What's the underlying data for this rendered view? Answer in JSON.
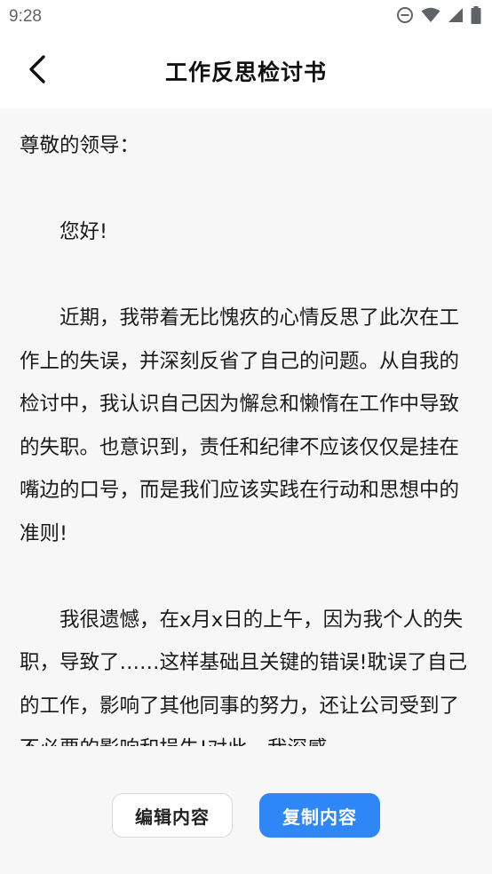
{
  "status_bar": {
    "time": "9:28",
    "icons": [
      "do-not-disturb-icon",
      "wifi-icon",
      "signal-icon",
      "battery-icon"
    ]
  },
  "header": {
    "title": "工作反思检讨书",
    "back_icon": "chevron-left-icon"
  },
  "document": {
    "salutation": "尊敬的领导：",
    "greeting": "您好!",
    "paragraphs": [
      "近期，我带着无比愧疚的心情反思了此次在工作上的失误，并深刻反省了自己的问题。从自我的检讨中，我认识自己因为懈怠和懒惰在工作中导致的失职。也意识到，责任和纪律不应该仅仅是挂在嘴边的口号，而是我们应该实践在行动和思想中的准则!",
      "我很遗憾，在x月x日的上午，因为我个人的失职，导致了……这样基础且关键的错误!耽误了自己的工作，影响了其他同事的努力，还让公司受到了不必要的影响和损失!对此，我深感"
    ]
  },
  "actions": {
    "edit_label": "编辑内容",
    "copy_label": "复制内容"
  },
  "colors": {
    "accent": "#2f86f6",
    "content_bg": "#f7f7f8"
  }
}
